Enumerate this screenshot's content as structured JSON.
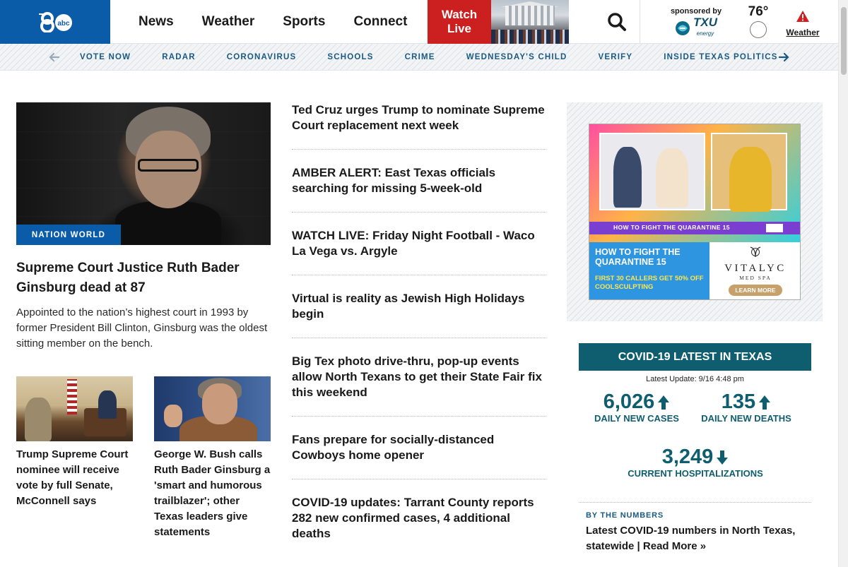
{
  "header": {
    "nav": [
      "News",
      "Weather",
      "Sports",
      "Connect"
    ],
    "watch_live_line1": "Watch",
    "watch_live_line2": "Live",
    "sponsor_label": "sponsored by",
    "sponsor_brand": "TXU",
    "sponsor_brand_sub": "energy",
    "temperature": "76°",
    "weather_label": "Weather"
  },
  "subnav": [
    "VOTE NOW",
    "RADAR",
    "CORONAVIRUS",
    "SCHOOLS",
    "CRIME",
    "WEDNESDAY'S CHILD",
    "VERIFY",
    "INSIDE TEXAS POLITICS"
  ],
  "lead": {
    "tag": "NATION WORLD",
    "title": "Supreme Court Justice Ruth Bader Ginsburg dead at 87",
    "summary": "Appointed to the nation’s highest court in 1993 by former President Bill Clinton, Ginsburg was the oldest sitting member on the bench."
  },
  "mini_stories": [
    {
      "title": "Trump Supreme Court nominee will receive vote by full Senate, McConnell says"
    },
    {
      "title": "George W. Bush calls Ruth Bader Ginsburg a 'smart and humorous trailblazer'; other Texas leaders give statements"
    }
  ],
  "headlines": [
    "Ted Cruz urges Trump to nominate Supreme Court replacement next week",
    "AMBER ALERT: East Texas officials searching for missing 5-week-old",
    "WATCH LIVE: Friday Night Football - Waco La Vega vs. Argyle",
    "Virtual is reality as Jewish High Holidays begin",
    "Big Tex photo drive-thru, pop-up events allow North Texans to get their State Fair fix this weekend",
    "Fans prepare for socially-distanced Cowboys home opener",
    "COVID-19 updates: Tarrant County reports 282 new confirmed cases, 4 additional deaths"
  ],
  "ad": {
    "lower_third": "HOW TO FIGHT THE QUARANTINE 15",
    "headline": "HOW TO FIGHT THE QUARANTINE 15",
    "offer": "FIRST 30 CALLERS GET 50% OFF COOLSCULPTING",
    "brand": "VITALYC",
    "brand_sub": "MED SPA",
    "cta": "LEARN MORE"
  },
  "covid": {
    "title": "COVID-19 LATEST IN TEXAS",
    "updated": "Latest Update: 9/16 4:48 pm",
    "stats": [
      {
        "value": "6,026",
        "label": "DAILY NEW CASES",
        "trend": "up"
      },
      {
        "value": "135",
        "label": "DAILY NEW DEATHS",
        "trend": "up"
      },
      {
        "value": "3,249",
        "label": "CURRENT HOSPITALIZATIONS",
        "trend": "down"
      }
    ],
    "kicker": "BY THE NUMBERS",
    "link": "Latest COVID-19 numbers in North Texas, statewide | Read More »"
  },
  "colors": {
    "brand_blue": "#0a5ca8",
    "live_red": "#cc1f1f",
    "covid_teal": "#0f5e6f",
    "subnav_text": "#1a5a82"
  }
}
